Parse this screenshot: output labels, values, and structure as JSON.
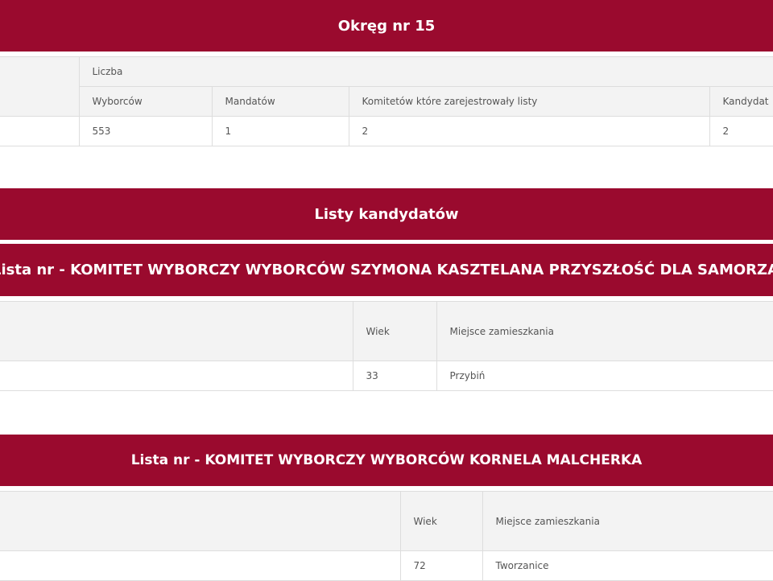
{
  "okreg": {
    "title": "Okręg nr 15",
    "group_header": "Liczba",
    "columns": [
      "Wyborców",
      "Mandatów",
      "Komitetów które zarejestrowały listy",
      "Kandydat"
    ],
    "values": [
      "553",
      "1",
      "2",
      "2"
    ]
  },
  "listy": {
    "title": "Listy kandydatów",
    "lists": [
      {
        "title": "Lista nr - KOMITET WYBORCZY WYBORCÓW SZYMONA KASZTELANA PRZYSZŁOŚĆ DLA SAMORZĄ",
        "columns": [
          "Wiek",
          "Miejsce zamieszkania"
        ],
        "rows": [
          [
            "33",
            "Przybiń"
          ]
        ]
      },
      {
        "title": "Lista nr - KOMITET WYBORCZY WYBORCÓW KORNELA MALCHERKA",
        "columns": [
          "Wiek",
          "Miejsce zamieszkania"
        ],
        "rows": [
          [
            "72",
            "Tworzanice"
          ]
        ]
      }
    ]
  },
  "colors": {
    "banner": "#9a0a2e",
    "header_row": "#f3f3f3",
    "border": "#dddddd",
    "text": "#555555"
  }
}
